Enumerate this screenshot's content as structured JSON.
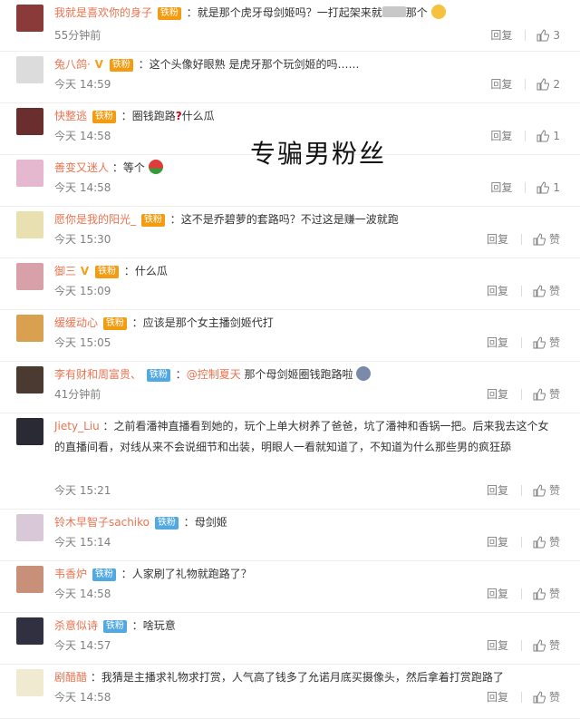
{
  "overlay_text": "专骗男粉丝",
  "actions": {
    "reply_label": "回复",
    "like_label": "赞"
  },
  "badges": {
    "iron_fan": "铁粉"
  },
  "comments": [
    {
      "user": "我就是喜欢你的身子",
      "badge": "铁粉",
      "text": "就是那个虎牙母剑姬吗？一打起架来就",
      "text2": "那个",
      "time": "55分钟前",
      "likes": "3"
    },
    {
      "user": "兔八鸽·",
      "badge": "铁粉",
      "text": "这个头像好眼熟 是虎牙那个玩剑姬的吗……",
      "time": "今天 14:59",
      "likes": "2"
    },
    {
      "user": "快整逃",
      "badge": "铁粉",
      "text": "圈钱跑路",
      "text2": "什么瓜",
      "time": "今天 14:58",
      "likes": "1"
    },
    {
      "user": "善变又迷人",
      "text": "等个",
      "time": "今天 14:58",
      "likes": "1"
    },
    {
      "user": "愿你是我的阳光_",
      "badge": "铁粉",
      "text": "这不是乔碧萝的套路吗？不过这是赚一波就跑",
      "time": "今天 15:30",
      "likes": "赞"
    },
    {
      "user": "御三",
      "badge": "铁粉",
      "text": "什么瓜",
      "time": "今天 15:09",
      "likes": "赞"
    },
    {
      "user": "缓缓动心",
      "badge": "铁粉",
      "text": "应该是那个女主播剑姬代打",
      "time": "今天 15:05",
      "likes": "赞"
    },
    {
      "user": "李有财和周富贵、",
      "badge": "铁粉",
      "mention": "@控制夏天",
      "text": "那个母剑姬圈钱跑路啦",
      "time": "41分钟前",
      "likes": "赞"
    },
    {
      "user": "Jiety_Liu",
      "text": "之前看潘神直播看到她的，玩个上单大树养了爸爸，坑了潘神和香锅一把。后来我去这个女的直播间看，对线从来不会说细节和出装，明眼人一看就知道了，不知道为什么那些男的疯狂舔",
      "time": "今天 15:21",
      "likes": "赞"
    },
    {
      "user": "铃木早智子sachiko",
      "badge": "铁粉",
      "text": "母剑姬",
      "time": "今天 15:14",
      "likes": "赞"
    },
    {
      "user": "韦香炉",
      "badge": "铁粉",
      "text": "人家刷了礼物就跑路了？",
      "time": "今天 14:58",
      "likes": "赞"
    },
    {
      "user": "杀意似诗",
      "badge": "铁粉",
      "text": "啥玩意",
      "time": "今天 14:57",
      "likes": "赞"
    },
    {
      "user": "剧醋醋",
      "text": "我猜是主播求礼物求打赏，人气高了钱多了允诺月底买摄像头，然后拿着打赏跑路了",
      "time": "今天 14:58",
      "likes": "赞"
    }
  ]
}
